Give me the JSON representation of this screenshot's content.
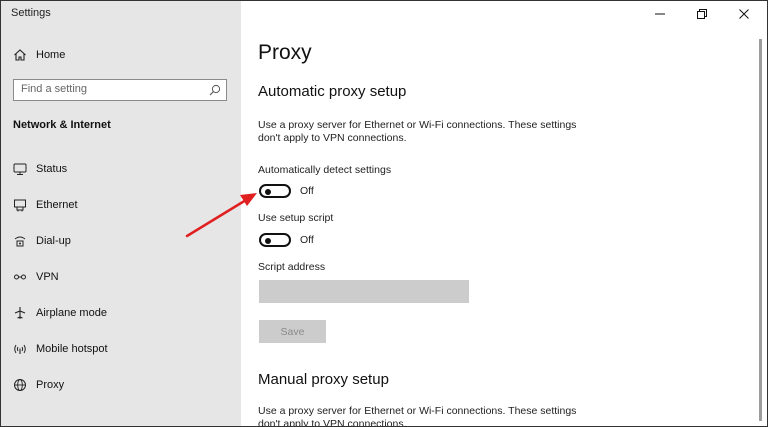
{
  "window": {
    "title": "Settings"
  },
  "sidebar": {
    "home_label": "Home",
    "search_placeholder": "Find a setting",
    "section_header": "Network & Internet",
    "items": [
      {
        "label": "Status",
        "icon": "globe-status-icon"
      },
      {
        "label": "Ethernet",
        "icon": "ethernet-icon"
      },
      {
        "label": "Dial-up",
        "icon": "dialup-icon"
      },
      {
        "label": "VPN",
        "icon": "vpn-icon"
      },
      {
        "label": "Airplane mode",
        "icon": "airplane-icon"
      },
      {
        "label": "Mobile hotspot",
        "icon": "hotspot-icon"
      },
      {
        "label": "Proxy",
        "icon": "globe-icon"
      }
    ]
  },
  "main": {
    "title": "Proxy",
    "auto": {
      "heading": "Automatic proxy setup",
      "description": "Use a proxy server for Ethernet or Wi-Fi connections. These settings don't apply to VPN connections.",
      "detect_label": "Automatically detect settings",
      "detect_state": "Off",
      "detect_on": false,
      "script_label": "Use setup script",
      "script_state": "Off",
      "script_on": false,
      "address_label": "Script address",
      "address_value": "",
      "save_label": "Save"
    },
    "manual": {
      "heading": "Manual proxy setup",
      "description": "Use a proxy server for Ethernet or Wi-Fi connections. These settings don't apply to VPN connections."
    }
  },
  "annotation": {
    "arrow_color": "#e02020"
  }
}
